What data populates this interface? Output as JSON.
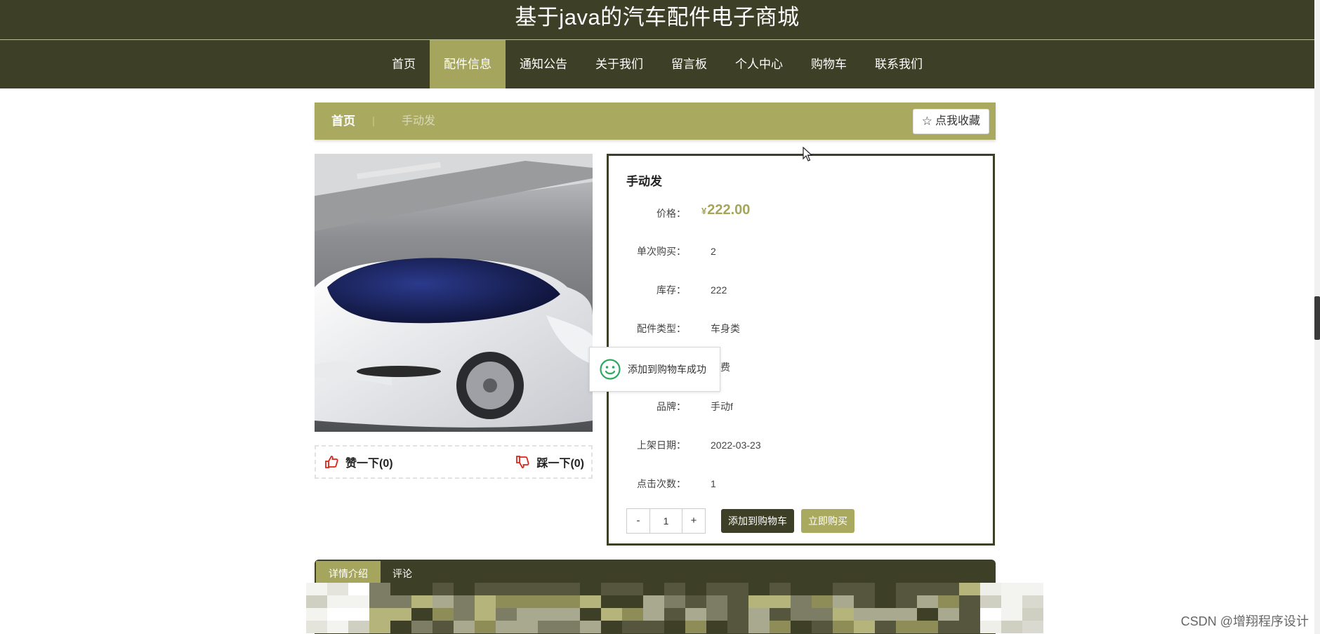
{
  "header": {
    "title": "基于java的汽车配件电子商城",
    "nav": [
      {
        "label": "首页",
        "active": false
      },
      {
        "label": "配件信息",
        "active": true
      },
      {
        "label": "通知公告",
        "active": false
      },
      {
        "label": "关于我们",
        "active": false
      },
      {
        "label": "留言板",
        "active": false
      },
      {
        "label": "个人中心",
        "active": false
      },
      {
        "label": "购物车",
        "active": false
      },
      {
        "label": "联系我们",
        "active": false
      }
    ]
  },
  "breadcrumb": {
    "home": "首页",
    "separator": "|",
    "current": "手动发",
    "favorite_label": "点我收藏"
  },
  "votes": {
    "like_label": "赞一下(0)",
    "dislike_label": "踩一下(0)"
  },
  "product": {
    "name": "手动发",
    "price_label": "价格：",
    "currency": "¥",
    "price": "222.00",
    "fields": [
      {
        "label": "单次购买：",
        "value": "2"
      },
      {
        "label": "库存：",
        "value": "222"
      },
      {
        "label": "配件类型：",
        "value": "车身类"
      },
      {
        "label": "",
        "value": "电费"
      },
      {
        "label": "品牌：",
        "value": "手动f"
      },
      {
        "label": "上架日期：",
        "value": "2022-03-23"
      },
      {
        "label": "点击次数：",
        "value": "1"
      }
    ],
    "qty_minus": "-",
    "quantity": "1",
    "qty_plus": "+",
    "add_to_cart": "添加到购物车",
    "buy_now": "立即购买"
  },
  "toast": {
    "message": "添加到购物车成功"
  },
  "tabs": [
    {
      "label": "详情介绍",
      "active": true
    },
    {
      "label": "评论",
      "active": false
    }
  ],
  "watermark": "CSDN @增翔程序设计",
  "colors": {
    "header_bg": "#3d3f27",
    "accent": "#a9a95f",
    "price": "#a6a55d"
  }
}
